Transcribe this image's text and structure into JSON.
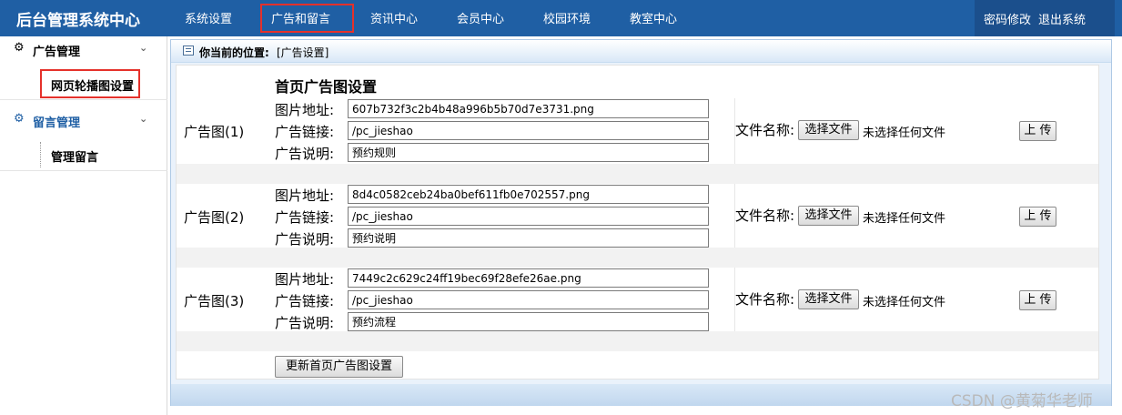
{
  "app": {
    "title": "后台管理系统中心"
  },
  "nav": {
    "items": [
      "系统设置",
      "广告和留言",
      "资讯中心",
      "会员中心",
      "校园环境",
      "教室中心"
    ],
    "active_index": 1
  },
  "topright": {
    "change_password": "密码修改",
    "logout": "退出系统"
  },
  "sidebar": {
    "groups": [
      {
        "label": "广告管理",
        "icon": "gear-icon",
        "items": [
          "网页轮播图设置"
        ]
      },
      {
        "label": "留言管理",
        "icon": "gear-icon",
        "items": [
          "管理留言"
        ]
      }
    ],
    "selected_item": "网页轮播图设置"
  },
  "breadcrumb": {
    "label": "你当前的位置:",
    "value": "[广告设置]"
  },
  "section": {
    "title": "首页广告图设置"
  },
  "fields": {
    "image_url": "图片地址:",
    "link": "广告链接:",
    "desc": "广告说明:",
    "file_name": "文件名称:"
  },
  "ads": [
    {
      "label": "广告图(1)",
      "image_url": "607b732f3c2b4b48a996b5b70d7e3731.png",
      "link": "/pc_jieshao",
      "desc": "预约规则"
    },
    {
      "label": "广告图(2)",
      "image_url": "8d4c0582ceb24ba0bef611fb0e702557.png",
      "link": "/pc_jieshao",
      "desc": "预约说明"
    },
    {
      "label": "广告图(3)",
      "image_url": "7449c2c629c24ff19bec69f28efe26ae.png",
      "link": "/pc_jieshao",
      "desc": "预约流程"
    }
  ],
  "file": {
    "choose_label": "选择文件",
    "no_file": "未选择任何文件",
    "upload_label": "上 传"
  },
  "submit": {
    "label": "更新首页广告图设置"
  },
  "watermark": "CSDN @黄菊华老师",
  "colors": {
    "topbar": "#1f5fa4",
    "highlight": "#e5312b",
    "panel": "#eaf2fb"
  }
}
